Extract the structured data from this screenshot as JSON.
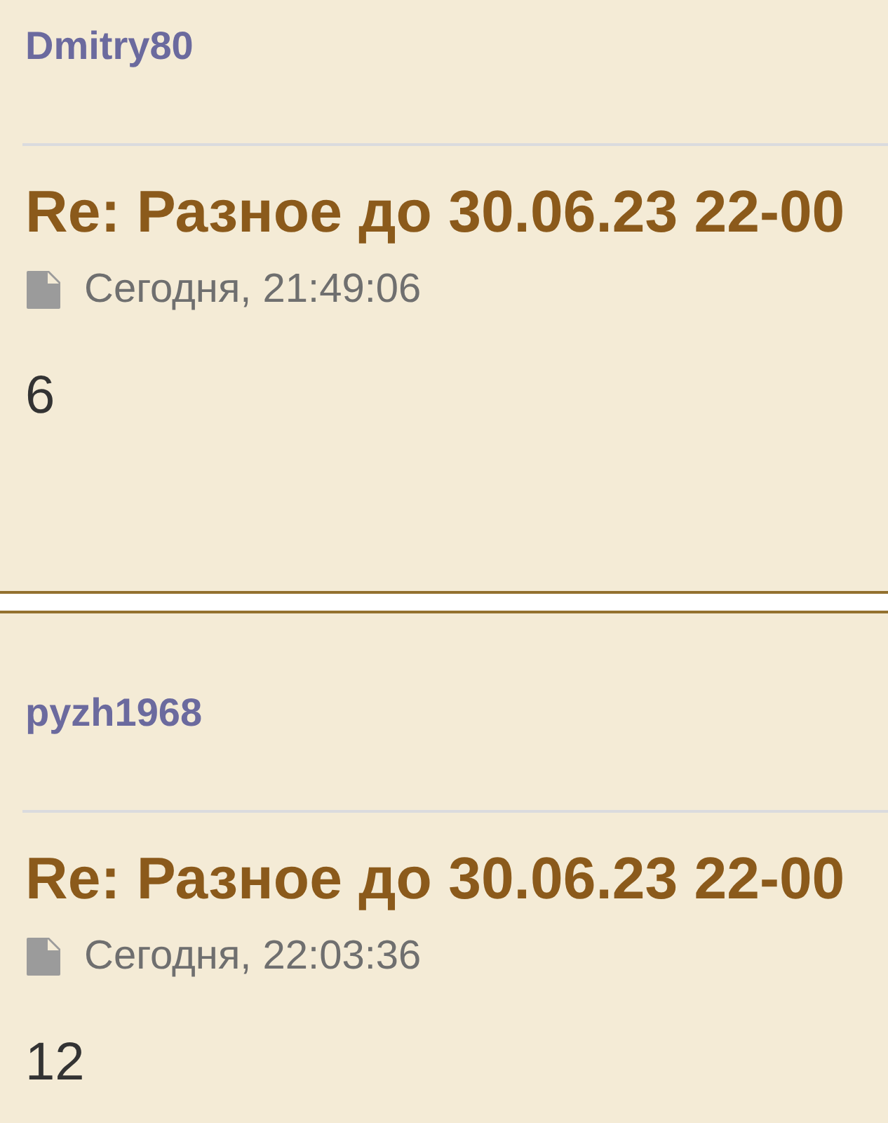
{
  "posts": [
    {
      "author": "Dmitry80",
      "title": "Re: Разное до 30.06.23 22-00",
      "date": "Сегодня, 21:49:06",
      "body": "6"
    },
    {
      "author": "pyzh1968",
      "title": "Re: Разное до 30.06.23 22-00",
      "date": "Сегодня, 22:03:36",
      "body": "12"
    }
  ]
}
